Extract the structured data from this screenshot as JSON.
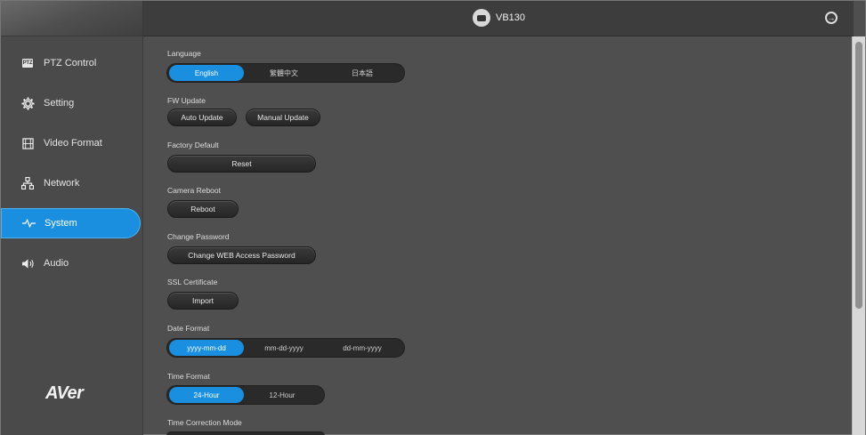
{
  "header": {
    "device_name": "VB130"
  },
  "sidebar": {
    "items": [
      {
        "label": "PTZ Control",
        "icon": "ptz-icon",
        "icon_text": "PTZ"
      },
      {
        "label": "Setting",
        "icon": "gear-icon"
      },
      {
        "label": "Video Format",
        "icon": "film-icon"
      },
      {
        "label": "Network",
        "icon": "network-icon"
      },
      {
        "label": "System",
        "icon": "pulse-icon",
        "active": true
      },
      {
        "label": "Audio",
        "icon": "speaker-icon"
      }
    ],
    "logo_text": "AVer"
  },
  "main": {
    "language": {
      "label": "Language",
      "options": [
        "English",
        "繁體中文",
        "日本語"
      ],
      "selected": "English"
    },
    "fw_update": {
      "label": "FW Update",
      "auto_label": "Auto Update",
      "manual_label": "Manual Update"
    },
    "factory_default": {
      "label": "Factory Default",
      "reset_label": "Reset"
    },
    "camera_reboot": {
      "label": "Camera Reboot",
      "reboot_label": "Reboot"
    },
    "change_password": {
      "label": "Change Password",
      "button_label": "Change WEB Access Password"
    },
    "ssl_certificate": {
      "label": "SSL Certificate",
      "import_label": "Import"
    },
    "date_format": {
      "label": "Date Format",
      "options": [
        "yyyy-mm-dd",
        "mm-dd-yyyy",
        "dd-mm-yyyy"
      ],
      "selected": "yyyy-mm-dd"
    },
    "time_format": {
      "label": "Time Format",
      "options": [
        "24-Hour",
        "12-Hour"
      ],
      "selected": "24-Hour"
    },
    "time_correction": {
      "label": "Time Correction Mode"
    }
  },
  "colors": {
    "accent": "#1a8fe0",
    "background": "#4f4f4f",
    "header": "#3d3d3d"
  }
}
